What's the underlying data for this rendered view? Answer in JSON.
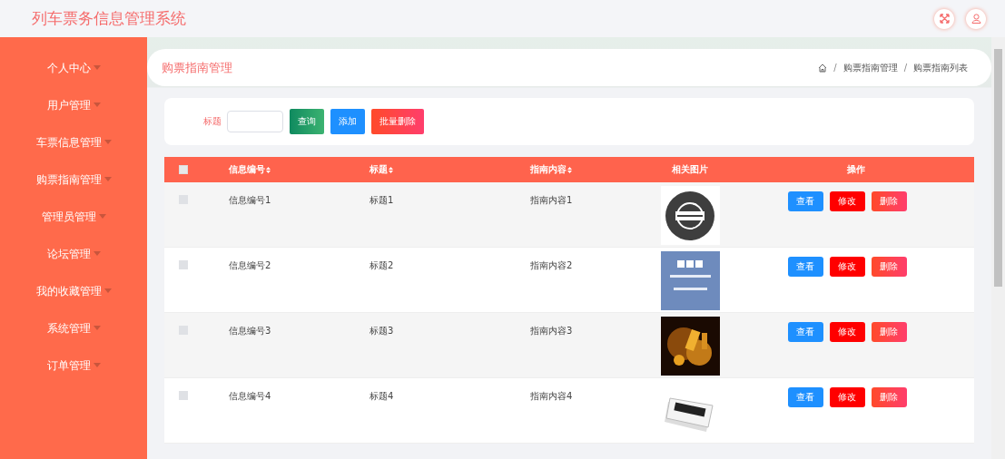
{
  "header": {
    "title": "列车票务信息管理系统"
  },
  "sidebar": {
    "items": [
      {
        "label": "个人中心"
      },
      {
        "label": "用户管理"
      },
      {
        "label": "车票信息管理"
      },
      {
        "label": "购票指南管理"
      },
      {
        "label": "管理员管理"
      },
      {
        "label": "论坛管理"
      },
      {
        "label": "我的收藏管理"
      },
      {
        "label": "系统管理"
      },
      {
        "label": "订单管理"
      }
    ]
  },
  "page_title": "购票指南管理",
  "breadcrumb": [
    {
      "kind": "separator",
      "text": "/"
    },
    {
      "kind": "link",
      "text": "购票指南管理"
    },
    {
      "kind": "separator",
      "text": "/"
    },
    {
      "kind": "link",
      "text": "购票指南列表"
    }
  ],
  "search": {
    "label": "标题",
    "buttons": [
      {
        "label": "查询",
        "kind": "query"
      },
      {
        "label": "添加",
        "kind": "add"
      },
      {
        "label": "批量删除",
        "kind": "delete"
      }
    ]
  },
  "table": {
    "select_all": {
      "checked": false
    },
    "columns": [
      {
        "label": "信息编号",
        "sortable": true
      },
      {
        "label": "标题",
        "sortable": true
      },
      {
        "label": "指南内容",
        "sortable": true
      },
      {
        "label": "相关图片",
        "sortable": false
      },
      {
        "label": "操作",
        "sortable": false
      }
    ],
    "rows": [
      {
        "checked": false,
        "id": "信息编号1",
        "title": "标题1",
        "content": "指南内容1",
        "image": {
          "kind": "picture"
        },
        "actions": [
          {
            "label": "查看",
            "kind": "view"
          },
          {
            "label": "修改",
            "kind": "edit"
          },
          {
            "label": "删除",
            "kind": "delete"
          }
        ]
      },
      {
        "checked": false,
        "id": "信息编号2",
        "title": "标题2",
        "content": "指南内容2",
        "image": {
          "kind": "picture"
        },
        "actions": [
          {
            "label": "查看",
            "kind": "view"
          },
          {
            "label": "修改",
            "kind": "edit"
          },
          {
            "label": "删除",
            "kind": "delete"
          }
        ]
      },
      {
        "checked": false,
        "id": "信息编号3",
        "title": "标题3",
        "content": "指南内容3",
        "image": {
          "kind": "picture"
        },
        "actions": [
          {
            "label": "查看",
            "kind": "view"
          },
          {
            "label": "修改",
            "kind": "edit"
          },
          {
            "label": "删除",
            "kind": "delete"
          }
        ]
      },
      {
        "checked": false,
        "id": "信息编号4",
        "title": "标题4",
        "content": "指南内容4",
        "image": {
          "kind": "picture"
        },
        "actions": [
          {
            "label": "查看",
            "kind": "view"
          },
          {
            "label": "修改",
            "kind": "edit"
          },
          {
            "label": "删除",
            "kind": "delete"
          }
        ]
      }
    ]
  }
}
